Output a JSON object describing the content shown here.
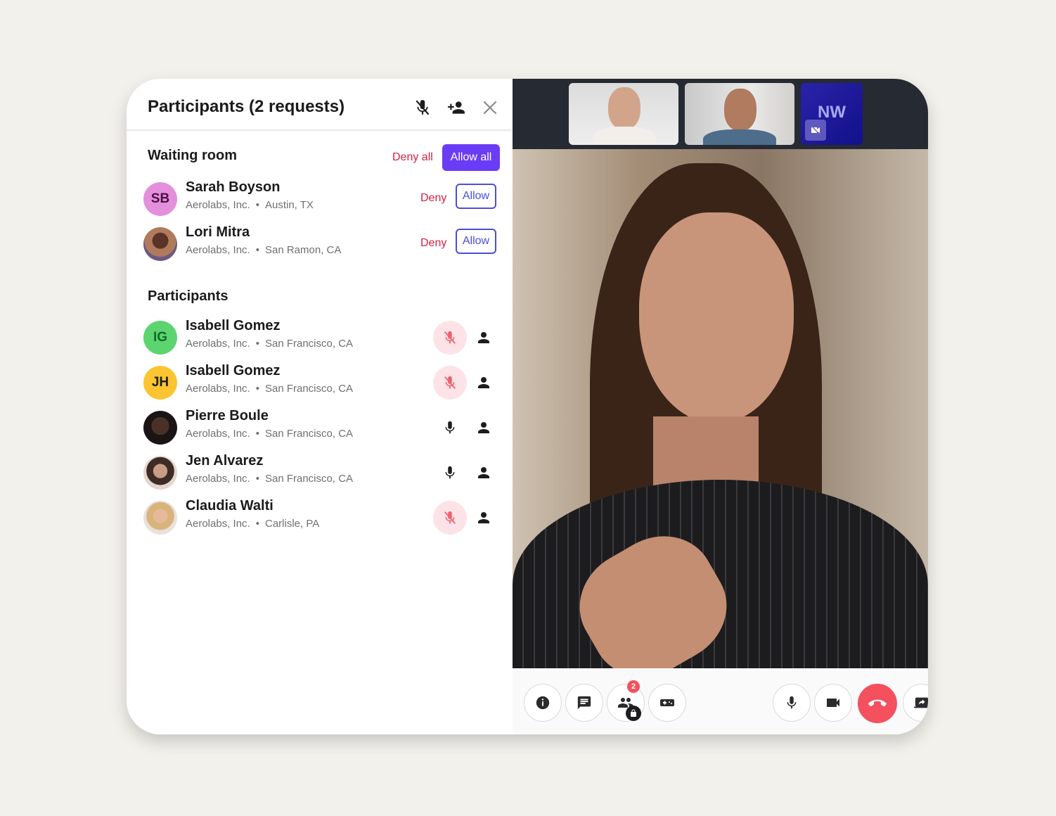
{
  "panel": {
    "title": "Participants (2 requests)",
    "header_icons": [
      "mute-all-icon",
      "add-person-icon",
      "close-icon"
    ]
  },
  "waiting_room": {
    "title": "Waiting room",
    "deny_all_label": "Deny all",
    "allow_all_label": "Allow all",
    "requests": [
      {
        "name": "Sarah Boyson",
        "company": "Aerolabs, Inc.",
        "location": "Austin, TX",
        "initials": "SB",
        "avatar_bg": "#e38fdc",
        "avatar_fg": "#4a1046",
        "deny_label": "Deny",
        "allow_label": "Allow"
      },
      {
        "name": "Lori Mitra",
        "company": "Aerolabs, Inc.",
        "location": "San Ramon, CA",
        "initials": "",
        "avatar_bg": "#8a5a44",
        "avatar_fg": "#ffffff",
        "deny_label": "Deny",
        "allow_label": "Allow"
      }
    ]
  },
  "participants": {
    "title": "Participants",
    "separator": "•",
    "items": [
      {
        "name": "Isabell Gomez",
        "company": "Aerolabs, Inc.",
        "location": "San Francisco, CA",
        "initials": "IG",
        "avatar_bg": "#5cd46f",
        "avatar_fg": "#0f6a2a",
        "muted": true
      },
      {
        "name": "Isabell Gomez",
        "company": "Aerolabs, Inc.",
        "location": "San Francisco, CA",
        "initials": "JH",
        "avatar_bg": "#fbc531",
        "avatar_fg": "#1b1b1d",
        "muted": true
      },
      {
        "name": "Pierre Boule",
        "company": "Aerolabs, Inc.",
        "location": "San Francisco, CA",
        "initials": "",
        "avatar_bg": "#2a2220",
        "avatar_fg": "#ffffff",
        "muted": false
      },
      {
        "name": "Jen Alvarez",
        "company": "Aerolabs, Inc.",
        "location": "San Francisco, CA",
        "initials": "",
        "avatar_bg": "#b9958a",
        "avatar_fg": "#ffffff",
        "muted": false
      },
      {
        "name": "Claudia Walti",
        "company": "Aerolabs, Inc.",
        "location": "Carlisle, PA",
        "initials": "",
        "avatar_bg": "#d9bfa5",
        "avatar_fg": "#ffffff",
        "muted": true
      }
    ]
  },
  "thumbnails": [
    {
      "type": "video",
      "label": ""
    },
    {
      "type": "video",
      "label": ""
    },
    {
      "type": "initials",
      "label": "NW",
      "camera_off": true
    }
  ],
  "controls": {
    "participants_badge": "2",
    "left": [
      "info-icon",
      "chat-icon",
      "participants-icon",
      "games-icon"
    ],
    "right": [
      "mic-icon",
      "camera-icon",
      "end-call-icon",
      "share-screen-icon"
    ]
  },
  "colors": {
    "accent": "#6b3cf5",
    "deny": "#d3223f",
    "allow_outline": "#4a4fd8",
    "end_call": "#f4505e",
    "muted_bg": "#fde3e7"
  }
}
